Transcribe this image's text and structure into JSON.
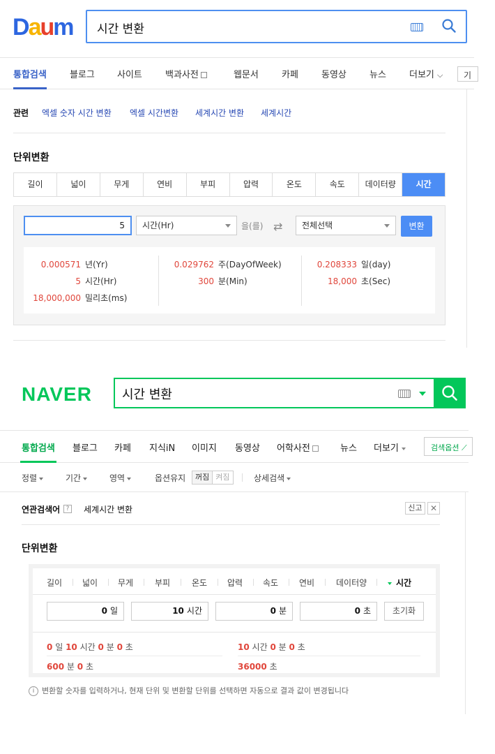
{
  "daum": {
    "logo": "Daum",
    "search": {
      "query": "시간 변환"
    },
    "nav": [
      {
        "label": "통합검색",
        "active": true
      },
      {
        "label": "블로그"
      },
      {
        "label": "사이트"
      },
      {
        "label": "백과사전"
      },
      {
        "label": "웹문서"
      },
      {
        "label": "카페"
      },
      {
        "label": "동영상"
      },
      {
        "label": "뉴스"
      },
      {
        "label": "더보기"
      }
    ],
    "nav_more_box": "기",
    "related": {
      "head": "관련",
      "links": [
        "엑셀 숫자 시간 변환",
        "엑셀 시간변환",
        "세계시간 변환",
        "세계시간"
      ]
    },
    "unit_title": "단위변환",
    "tabs": [
      "길이",
      "넓이",
      "무게",
      "연비",
      "부피",
      "압력",
      "온도",
      "속도",
      "데이터량",
      "시간"
    ],
    "active_tab": "시간",
    "calc": {
      "input_value": "5",
      "from_unit": "시간(Hr)",
      "particle": "을(를)",
      "to_unit": "전체선택",
      "convert_label": "변환"
    },
    "results": [
      {
        "value": "0.000571",
        "unit": "년(Yr)"
      },
      {
        "value": "5",
        "unit": "시간(Hr)"
      },
      {
        "value": "18,000,000",
        "unit": "밀리초(ms)"
      },
      {
        "value": "0.029762",
        "unit": "주(DayOfWeek)"
      },
      {
        "value": "300",
        "unit": "분(Min)"
      },
      {
        "value": "0.208333",
        "unit": "일(day)"
      },
      {
        "value": "18,000",
        "unit": "초(Sec)"
      }
    ]
  },
  "naver": {
    "logo": "NAVER",
    "search": {
      "query": "시간 변환"
    },
    "nav": [
      {
        "label": "통합검색",
        "active": true
      },
      {
        "label": "블로그"
      },
      {
        "label": "카페"
      },
      {
        "label": "지식iN"
      },
      {
        "label": "이미지"
      },
      {
        "label": "동영상"
      },
      {
        "label": "어학사전"
      },
      {
        "label": "뉴스"
      },
      {
        "label": "더보기"
      }
    ],
    "search_options": "검색옵션",
    "filters": {
      "sort": "정렬",
      "period": "기간",
      "area": "영역",
      "keep_option": "옵션유지",
      "toggle_off": "꺼짐",
      "toggle_on": "켜짐",
      "advanced": "상세검색"
    },
    "related": {
      "head": "연관검색어",
      "help": "?",
      "link": "세계시간 변환",
      "report": "신고",
      "close": "✕"
    },
    "unit_title": "단위변환",
    "tabs": [
      "길이",
      "넓이",
      "무게",
      "부피",
      "온도",
      "압력",
      "속도",
      "연비",
      "데이터양",
      "시간"
    ],
    "active_tab": "시간",
    "inputs": [
      {
        "value": "0",
        "unit": "일"
      },
      {
        "value": "10",
        "unit": "시간"
      },
      {
        "value": "0",
        "unit": "분"
      },
      {
        "value": "0",
        "unit": "초"
      }
    ],
    "reset_label": "초기화",
    "results": {
      "r1": {
        "d": "0",
        "du": "일",
        "h": "10",
        "hu": "시간",
        "m": "0",
        "mu": "분",
        "s": "0",
        "su": "초"
      },
      "r2": {
        "h": "10",
        "hu": "시간",
        "m": "0",
        "mu": "분",
        "s": "0",
        "su": "초"
      },
      "r3": {
        "m": "600",
        "mu": "분",
        "s": "0",
        "su": "초"
      },
      "r4": {
        "s": "36000",
        "su": "초"
      }
    },
    "hint": "변환할 숫자를 입력하거나, 현재 단위 및 변환할 단위를 선택하면 자동으로 결과 값이 변경됩니다"
  },
  "colors": {
    "daum_blue": "#4c8df5",
    "naver_green": "#03c75a",
    "result_red": "#e0463b"
  }
}
